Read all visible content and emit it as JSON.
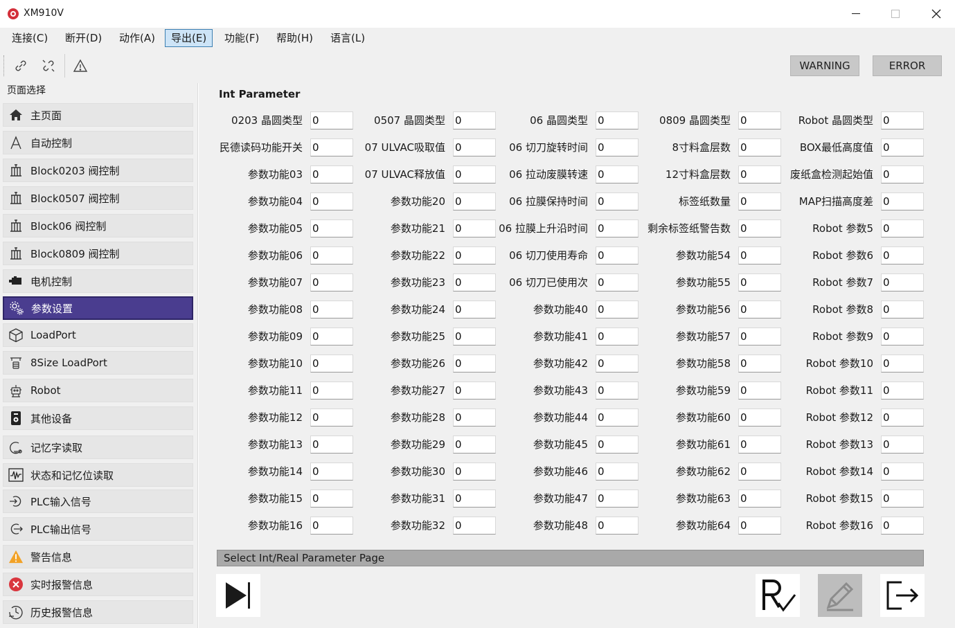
{
  "window": {
    "title": "XM910V",
    "minimize_label": "—",
    "maximize_label": "☐",
    "close_label": "✕"
  },
  "menu": {
    "items": [
      {
        "label": "连接(C)"
      },
      {
        "label": "断开(D)"
      },
      {
        "label": "动作(A)"
      },
      {
        "label": "导出(E)",
        "active": true
      },
      {
        "label": "功能(F)"
      },
      {
        "label": "帮助(H)"
      },
      {
        "label": "语言(L)"
      }
    ]
  },
  "toolbar": {
    "icons": [
      "link-icon",
      "unlink-icon",
      "warning-reset-icon"
    ],
    "warning_label": "WARNING",
    "error_label": "ERROR"
  },
  "sidebar": {
    "title": "页面选择",
    "selected_color": "#4a3d8f",
    "items": [
      {
        "label": "主页面",
        "icon": "home-icon"
      },
      {
        "label": "自动控制",
        "icon": "auto-icon"
      },
      {
        "label": "Block0203 阀控制",
        "icon": "valve-icon"
      },
      {
        "label": "Block0507 阀控制",
        "icon": "valve-icon"
      },
      {
        "label": "Block06 阀控制",
        "icon": "valve-icon"
      },
      {
        "label": "Block0809 阀控制",
        "icon": "valve-icon"
      },
      {
        "label": "电机控制",
        "icon": "motor-icon"
      },
      {
        "label": "参数设置",
        "icon": "settings-icon",
        "selected": true
      },
      {
        "label": "LoadPort",
        "icon": "box-icon"
      },
      {
        "label": "8Size LoadPort",
        "icon": "loadport-icon"
      },
      {
        "label": "Robot",
        "icon": "robot-icon"
      },
      {
        "label": "其他设备",
        "icon": "device-icon"
      },
      {
        "label": "记忆字读取",
        "icon": "memory-icon"
      },
      {
        "label": "状态和记忆位读取",
        "icon": "signal-icon"
      },
      {
        "label": "PLC输入信号",
        "icon": "input-icon"
      },
      {
        "label": "PLC输出信号",
        "icon": "output-icon"
      },
      {
        "label": "警告信息",
        "icon": "warning-icon"
      },
      {
        "label": "实时报警信息",
        "icon": "error-icon"
      },
      {
        "label": "历史报警信息",
        "icon": "history-icon"
      }
    ]
  },
  "main": {
    "section_title": "Int Parameter",
    "columns": [
      [
        "0203 晶圆类型",
        "民德读码功能开关",
        "参数功能03",
        "参数功能04",
        "参数功能05",
        "参数功能06",
        "参数功能07",
        "参数功能08",
        "参数功能09",
        "参数功能10",
        "参数功能11",
        "参数功能12",
        "参数功能13",
        "参数功能14",
        "参数功能15",
        "参数功能16"
      ],
      [
        "0507 晶圆类型",
        "07 ULVAC吸取值",
        "07 ULVAC释放值",
        "参数功能20",
        "参数功能21",
        "参数功能22",
        "参数功能23",
        "参数功能24",
        "参数功能25",
        "参数功能26",
        "参数功能27",
        "参数功能28",
        "参数功能29",
        "参数功能30",
        "参数功能31",
        "参数功能32"
      ],
      [
        "06 晶圆类型",
        "06 切刀旋转时间",
        "06 拉动废膜转速",
        "06 拉膜保持时间",
        "06 拉膜上升沿时间",
        "06 切刀使用寿命",
        "06 切刀已使用次",
        "参数功能40",
        "参数功能41",
        "参数功能42",
        "参数功能43",
        "参数功能44",
        "参数功能45",
        "参数功能46",
        "参数功能47",
        "参数功能48"
      ],
      [
        "0809 晶圆类型",
        "8寸料盒层数",
        "12寸料盒层数",
        "标签纸数量",
        "剩余标签纸警告数",
        "参数功能54",
        "参数功能55",
        "参数功能56",
        "参数功能57",
        "参数功能58",
        "参数功能59",
        "参数功能60",
        "参数功能61",
        "参数功能62",
        "参数功能63",
        "参数功能64"
      ],
      [
        "Robot 晶圆类型",
        "BOX最低高度值",
        "废纸盒检测起始值",
        "MAP扫描高度差",
        "Robot 参数5",
        "Robot 参数6",
        "Robot 参数7",
        "Robot 参数8",
        "Robot 参数9",
        "Robot 参数10",
        "Robot 参数11",
        "Robot 参数12",
        "Robot 参数13",
        "Robot 参数14",
        "Robot 参数15",
        "Robot 参数16"
      ]
    ],
    "default_value": "0",
    "page_bar_label": "Select Int/Real Parameter Page",
    "actions": [
      {
        "name": "next-page-button",
        "icon": "play-next-icon"
      },
      {
        "name": "read-button",
        "icon": "read-check-icon"
      },
      {
        "name": "write-button",
        "icon": "pencil-icon",
        "disabled": true
      },
      {
        "name": "exit-button",
        "icon": "exit-icon"
      }
    ]
  }
}
